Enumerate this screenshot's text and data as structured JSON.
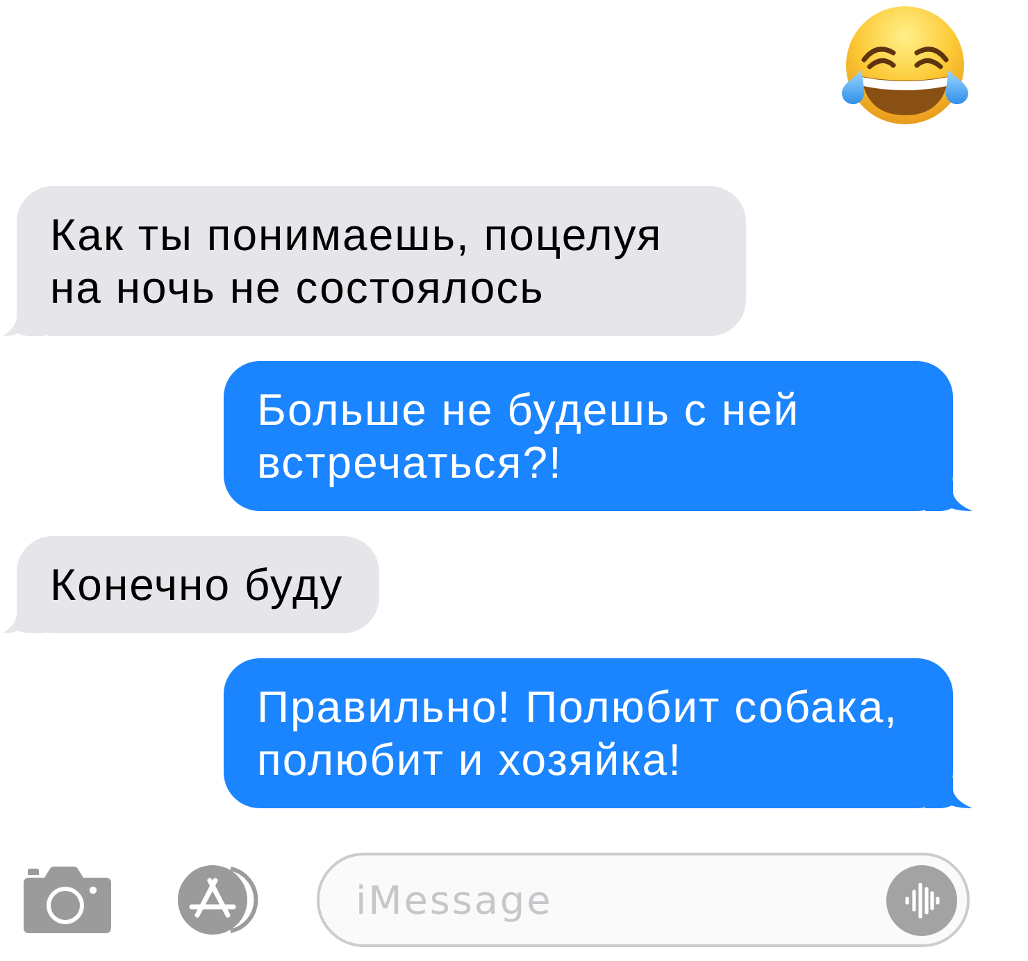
{
  "conversation": {
    "messages": [
      {
        "kind": "emoji",
        "outgoing": true
      },
      {
        "kind": "text",
        "outgoing": false,
        "text": "Как ты понимаешь, поцелуя на ночь не состоялось"
      },
      {
        "kind": "text",
        "outgoing": true,
        "text": "Больше не будешь с ней встречаться?!"
      },
      {
        "kind": "text",
        "outgoing": false,
        "text": "Конечно буду"
      },
      {
        "kind": "text",
        "outgoing": true,
        "text": "Правильно! Полюбит собака, полюбит и хозяйка!"
      }
    ]
  },
  "composer": {
    "placeholder": "iMessage"
  }
}
